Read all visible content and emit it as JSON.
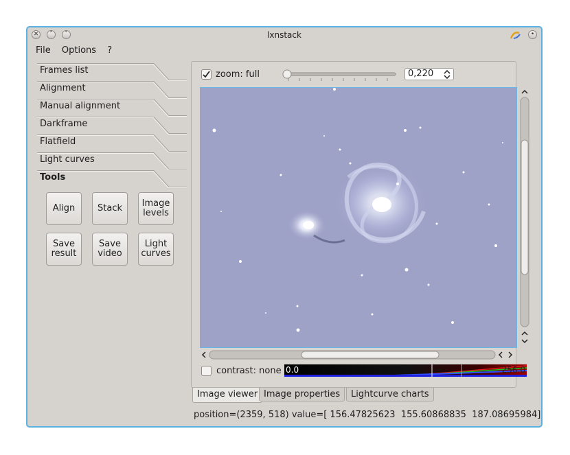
{
  "window": {
    "title": "lxnstack",
    "controls": [
      "close-icon",
      "minimize-icon",
      "maximize-icon"
    ]
  },
  "menu": {
    "items": [
      "File",
      "Options",
      "?"
    ]
  },
  "sidebar": {
    "tabs": [
      "Frames list",
      "Alignment",
      "Manual alignment",
      "Darkframe",
      "Flatfield",
      "Light curves",
      "Tools"
    ],
    "active_tab": "Tools",
    "tools": [
      "Align",
      "Stack",
      "Image\nlevels",
      "Save\nresult",
      "Save\nvideo",
      "Light\ncurves"
    ]
  },
  "viewer": {
    "zoom_checked": true,
    "zoom_label": "zoom: full",
    "zoom_value": "0,220",
    "contrast_checked": false,
    "contrast_label": "contrast: none",
    "histogram_min": "0.0",
    "histogram_max": "256.0",
    "image_bg": "#9fa2c7"
  },
  "bottom_tabs": {
    "items": [
      "Image viewer",
      "Image properties",
      "Lightcurve charts"
    ],
    "active": "Image viewer"
  },
  "status": {
    "text": "position=(2359, 518) value=[ 156.47825623  155.60868835  187.08695984]"
  },
  "colors": {
    "accent": "#5ab0e0",
    "window_bg": "#d6d3ce"
  }
}
